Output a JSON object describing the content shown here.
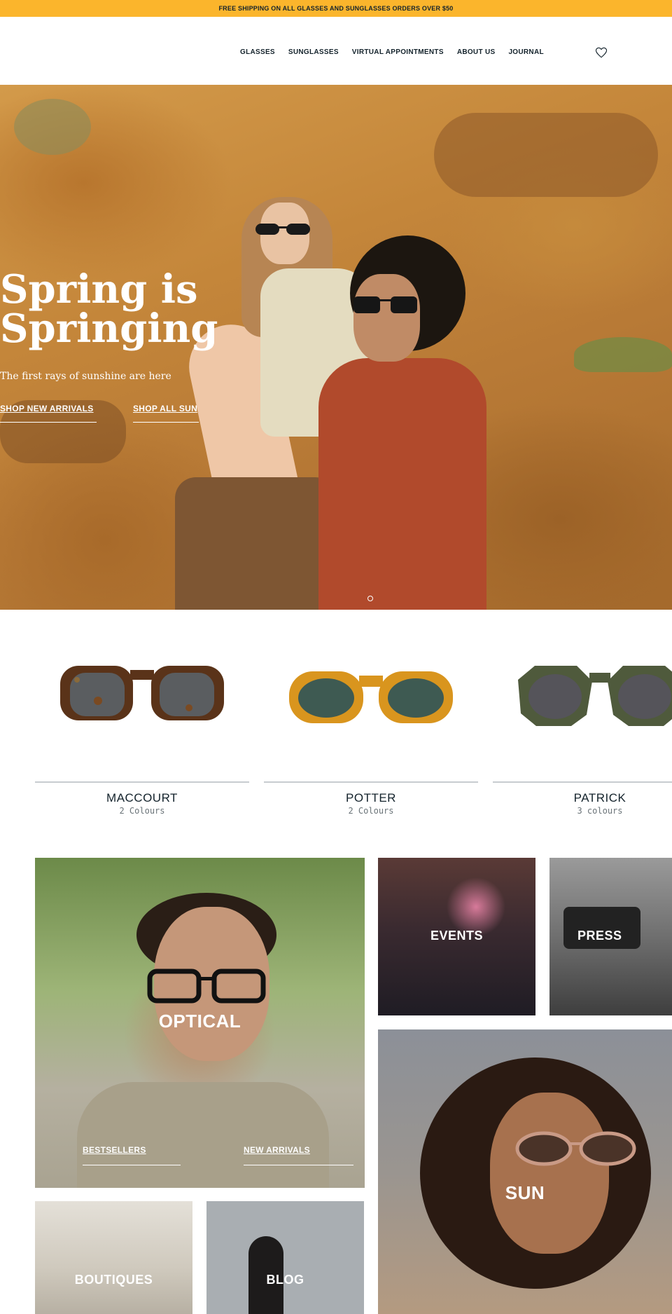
{
  "announcement": "FREE SHIPPING ON ALL GLASSES AND SUNGLASSES ORDERS OVER $50",
  "nav": {
    "items": [
      "GLASSES",
      "SUNGLASSES",
      "VIRTUAL APPOINTMENTS",
      "ABOUT US",
      "JOURNAL"
    ],
    "wishlist_icon": "heart-icon"
  },
  "hero": {
    "title_line1": "Spring is",
    "title_line2": "Springing",
    "subtitle": "The first rays of sunshine are here",
    "cta_primary": "SHOP NEW ARRIVALS",
    "cta_secondary": "SHOP ALL SUN",
    "slide_dots": 1
  },
  "products": [
    {
      "name": "MACCOURT",
      "colours": "2 Colours",
      "frame_color": "#5a3319",
      "lens_color": "#5a5d60"
    },
    {
      "name": "POTTER",
      "colours": "2 Colours",
      "frame_color": "#d9951e",
      "lens_color": "#3e5a52"
    },
    {
      "name": "PATRICK",
      "colours": "3 colours",
      "frame_color": "#4f5a3c",
      "lens_color": "#55545a"
    }
  ],
  "tiles": {
    "optical": {
      "label": "OPTICAL",
      "link1": "BESTSELLERS",
      "link2": "NEW ARRIVALS"
    },
    "events": {
      "label": "EVENTS"
    },
    "press": {
      "label": "PRESS"
    },
    "sun": {
      "label": "SUN"
    },
    "boutiques": {
      "label": "BOUTIQUES"
    },
    "blog": {
      "label": "BLOG"
    }
  },
  "colors": {
    "announcement_bg": "#fbb52c",
    "text_dark": "#14232c"
  }
}
